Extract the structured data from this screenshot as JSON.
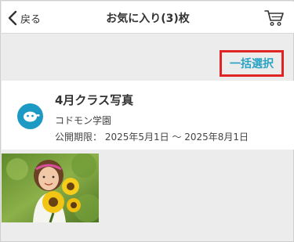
{
  "header": {
    "back_label": "戻る",
    "title": "お気に入り(3)枚"
  },
  "actions": {
    "bulk_select_label": "一括選択"
  },
  "album": {
    "title": "4月クラス写真",
    "school": "コドモン学園",
    "period": "公開期限： 2025年5月1日 〜 2025年8月1日"
  },
  "colors": {
    "accent": "#29a3c4",
    "logo": "#1c9ac3",
    "highlight_border": "#e02424",
    "background": "#ececec"
  },
  "icons": {
    "back": "chevron-left-icon",
    "cart": "cart-icon",
    "logo": "app-logo-icon"
  },
  "photos": [
    {
      "description_icon": "photo-thumbnail"
    }
  ]
}
